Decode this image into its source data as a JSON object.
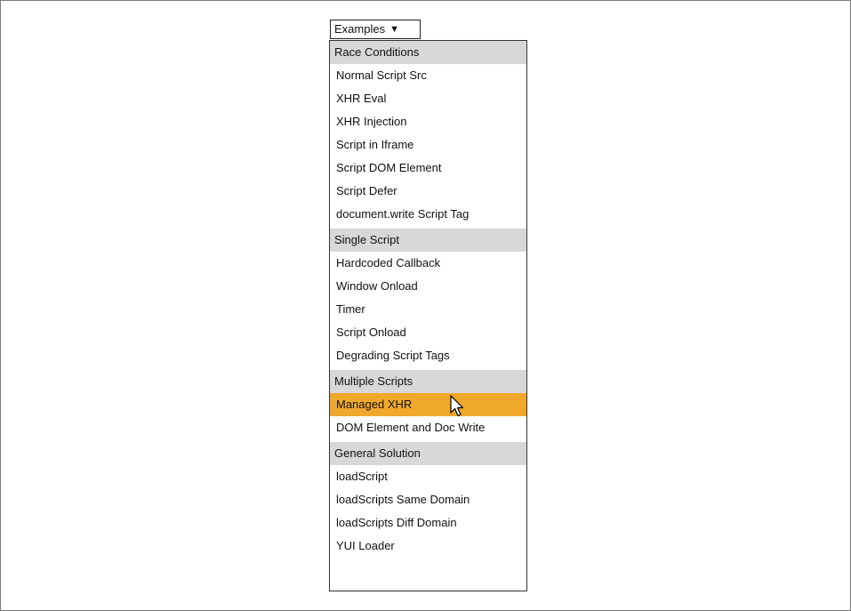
{
  "dropdown": {
    "label": "Examples",
    "arrow": "▼"
  },
  "groups": [
    {
      "header": "Race Conditions",
      "items": [
        "Normal Script Src",
        "XHR Eval",
        "XHR Injection",
        "Script in Iframe",
        "Script DOM Element",
        "Script Defer",
        "document.write Script Tag"
      ]
    },
    {
      "header": "Single Script",
      "items": [
        "Hardcoded Callback",
        "Window Onload",
        "Timer",
        "Script Onload",
        "Degrading Script Tags"
      ]
    },
    {
      "header": "Multiple Scripts",
      "items": [
        "Managed XHR",
        "DOM Element and Doc Write"
      ]
    },
    {
      "header": "General Solution",
      "items": [
        "loadScript",
        "loadScripts Same Domain",
        "loadScripts Diff Domain",
        "YUI Loader"
      ]
    }
  ],
  "highlighted_item": "Managed XHR",
  "colors": {
    "highlight": "#f0a82c",
    "group_header_bg": "#d8d8d8"
  },
  "icons": {
    "cursor": "mouse-pointer-icon",
    "dropdown_arrow": "triangle-down-icon"
  }
}
